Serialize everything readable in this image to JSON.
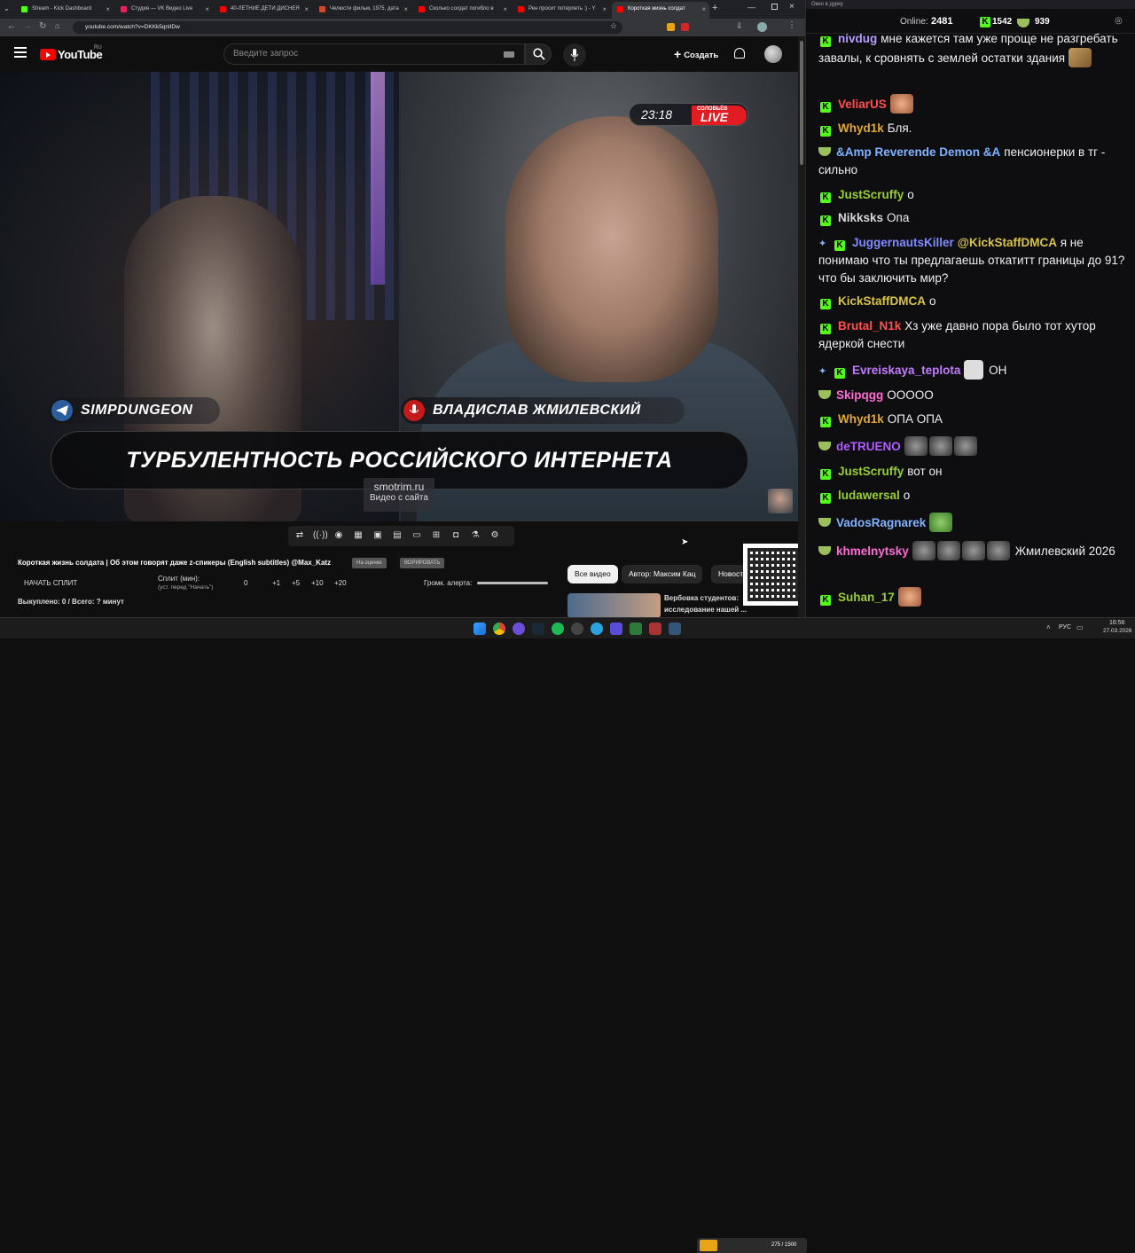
{
  "browser": {
    "tabs": [
      {
        "title": "Stream - Kick Dashboard",
        "color": "#53fc18"
      },
      {
        "title": "Студия — VK Видео Live",
        "color": "#e0245e"
      },
      {
        "title": "40-ЛЕТНИЕ ДЕТИ ДИСНЕЯ",
        "color": "#ff0000"
      },
      {
        "title": "Челюсти фильм, 1975, дата",
        "color": "#d04a2a"
      },
      {
        "title": "Сколько солдат погибло в",
        "color": "#ff0000"
      },
      {
        "title": "Рен просит потерпеть :) - Y",
        "color": "#ff0000"
      },
      {
        "title": "Короткая жизнь солдат",
        "color": "#ff0000"
      }
    ],
    "url": "youtube.com/watch?v=DKKk5qnlIDw"
  },
  "youtube": {
    "logo_text": "YouTube",
    "region": "RU",
    "search_placeholder": "Введите запрос",
    "create_label": "Создать"
  },
  "video": {
    "live_time": "23:18",
    "live_brand": "СОЛОВЬЁВ",
    "live_word": "LIVE",
    "left_name": "SIMPDUNGEON",
    "right_name": "ВЛАДИСЛАВ ЖМИЛЕВСКИЙ",
    "headline": "ТУРБУЛЕНТНОСТЬ РОССИЙСКОГО ИНТЕРНЕТА",
    "watermark_site": "smotrim.ru",
    "watermark_caption": "Видео с сайта"
  },
  "below": {
    "title": "Короткая жизнь солдата | Об этом говорят даже z-спикеры (English subtitles) @Max_Katz",
    "pill1": "На оценке",
    "pill2": "ВОРИРОВАТЬ",
    "split_button": "НАЧАТЬ СПЛИТ",
    "split_label": "Сплит (мин):",
    "split_sub": "(уст. перед \"Начать\")",
    "split_values": [
      "0",
      "+1",
      "+5",
      "+10",
      "+20"
    ],
    "alert_label": "Громк. алерта:",
    "redeemed": "Выкуплено: 0 / Всего: ? минут",
    "chips": [
      "Все видео",
      "Автор: Максим Кац",
      "Новост"
    ],
    "rec_title_1": "Вербовка студентов:",
    "rec_title_2": "исследование нашей ..."
  },
  "chat": {
    "window_title": "Окно в дурку",
    "online_label": "Online:",
    "online_count": "2481",
    "count_a": "1542",
    "count_b": "939",
    "messages": [
      {
        "user": "nivdug",
        "color": "#b59cff",
        "text": "мне кажется там уже проще не разгребать завалы, к сровнять с землей остатки здания"
      },
      {
        "user": "VeliarUS",
        "color": "#ff4f4f",
        "text": ""
      },
      {
        "user": "Whyd1k",
        "color": "#e0a82e",
        "text": "Бля."
      },
      {
        "user": "&Amp Reverende Demon &A",
        "color": "#7fb3ff",
        "text": "пенсионерки в тг - сильно"
      },
      {
        "user": "JustScruffy",
        "color": "#9acd32",
        "text": "о"
      },
      {
        "user": "Nikksks",
        "color": "#d8d8d8",
        "text": "Опа"
      },
      {
        "user": "JuggernautsKiller",
        "color": "#7f8cff",
        "mention": "@KickStaffDMCA",
        "text": "я не понимаю что ты предлагаешь откатитт границы до 91? что бы заключить мир?"
      },
      {
        "user": "KickStaffDMCA",
        "color": "#d9c44a",
        "text": "о"
      },
      {
        "user": "Brutal_N1k",
        "color": "#ff4f4f",
        "text": "Хз уже давно пора было тот хутор ядеркой снести"
      },
      {
        "user": "Evreiskaya_teplota",
        "color": "#c27bff",
        "text": "ОН"
      },
      {
        "user": "Skipqgg",
        "color": "#ff6ad5",
        "text": "ООООО"
      },
      {
        "user": "Whyd1k",
        "color": "#e0a82e",
        "text": "ОПА ОПА"
      },
      {
        "user": "deTRUENO",
        "color": "#b05cff",
        "text": ""
      },
      {
        "user": "JustScruffy",
        "color": "#9acd32",
        "text": "вот он"
      },
      {
        "user": "ludawersal",
        "color": "#9acd32",
        "text": "о"
      },
      {
        "user": "VadosRagnarek",
        "color": "#7fb3ff",
        "text": ""
      },
      {
        "user": "khmelnytsky",
        "color": "#ff6ad5",
        "text": "Жмилевский 2026"
      },
      {
        "user": "Suhan_17",
        "color": "#9acd32",
        "text": ""
      }
    ]
  },
  "taskbar": {
    "now_playing": "275 / 1500",
    "lang": "РУС",
    "time": "16:56",
    "date": "27.03.2026"
  }
}
